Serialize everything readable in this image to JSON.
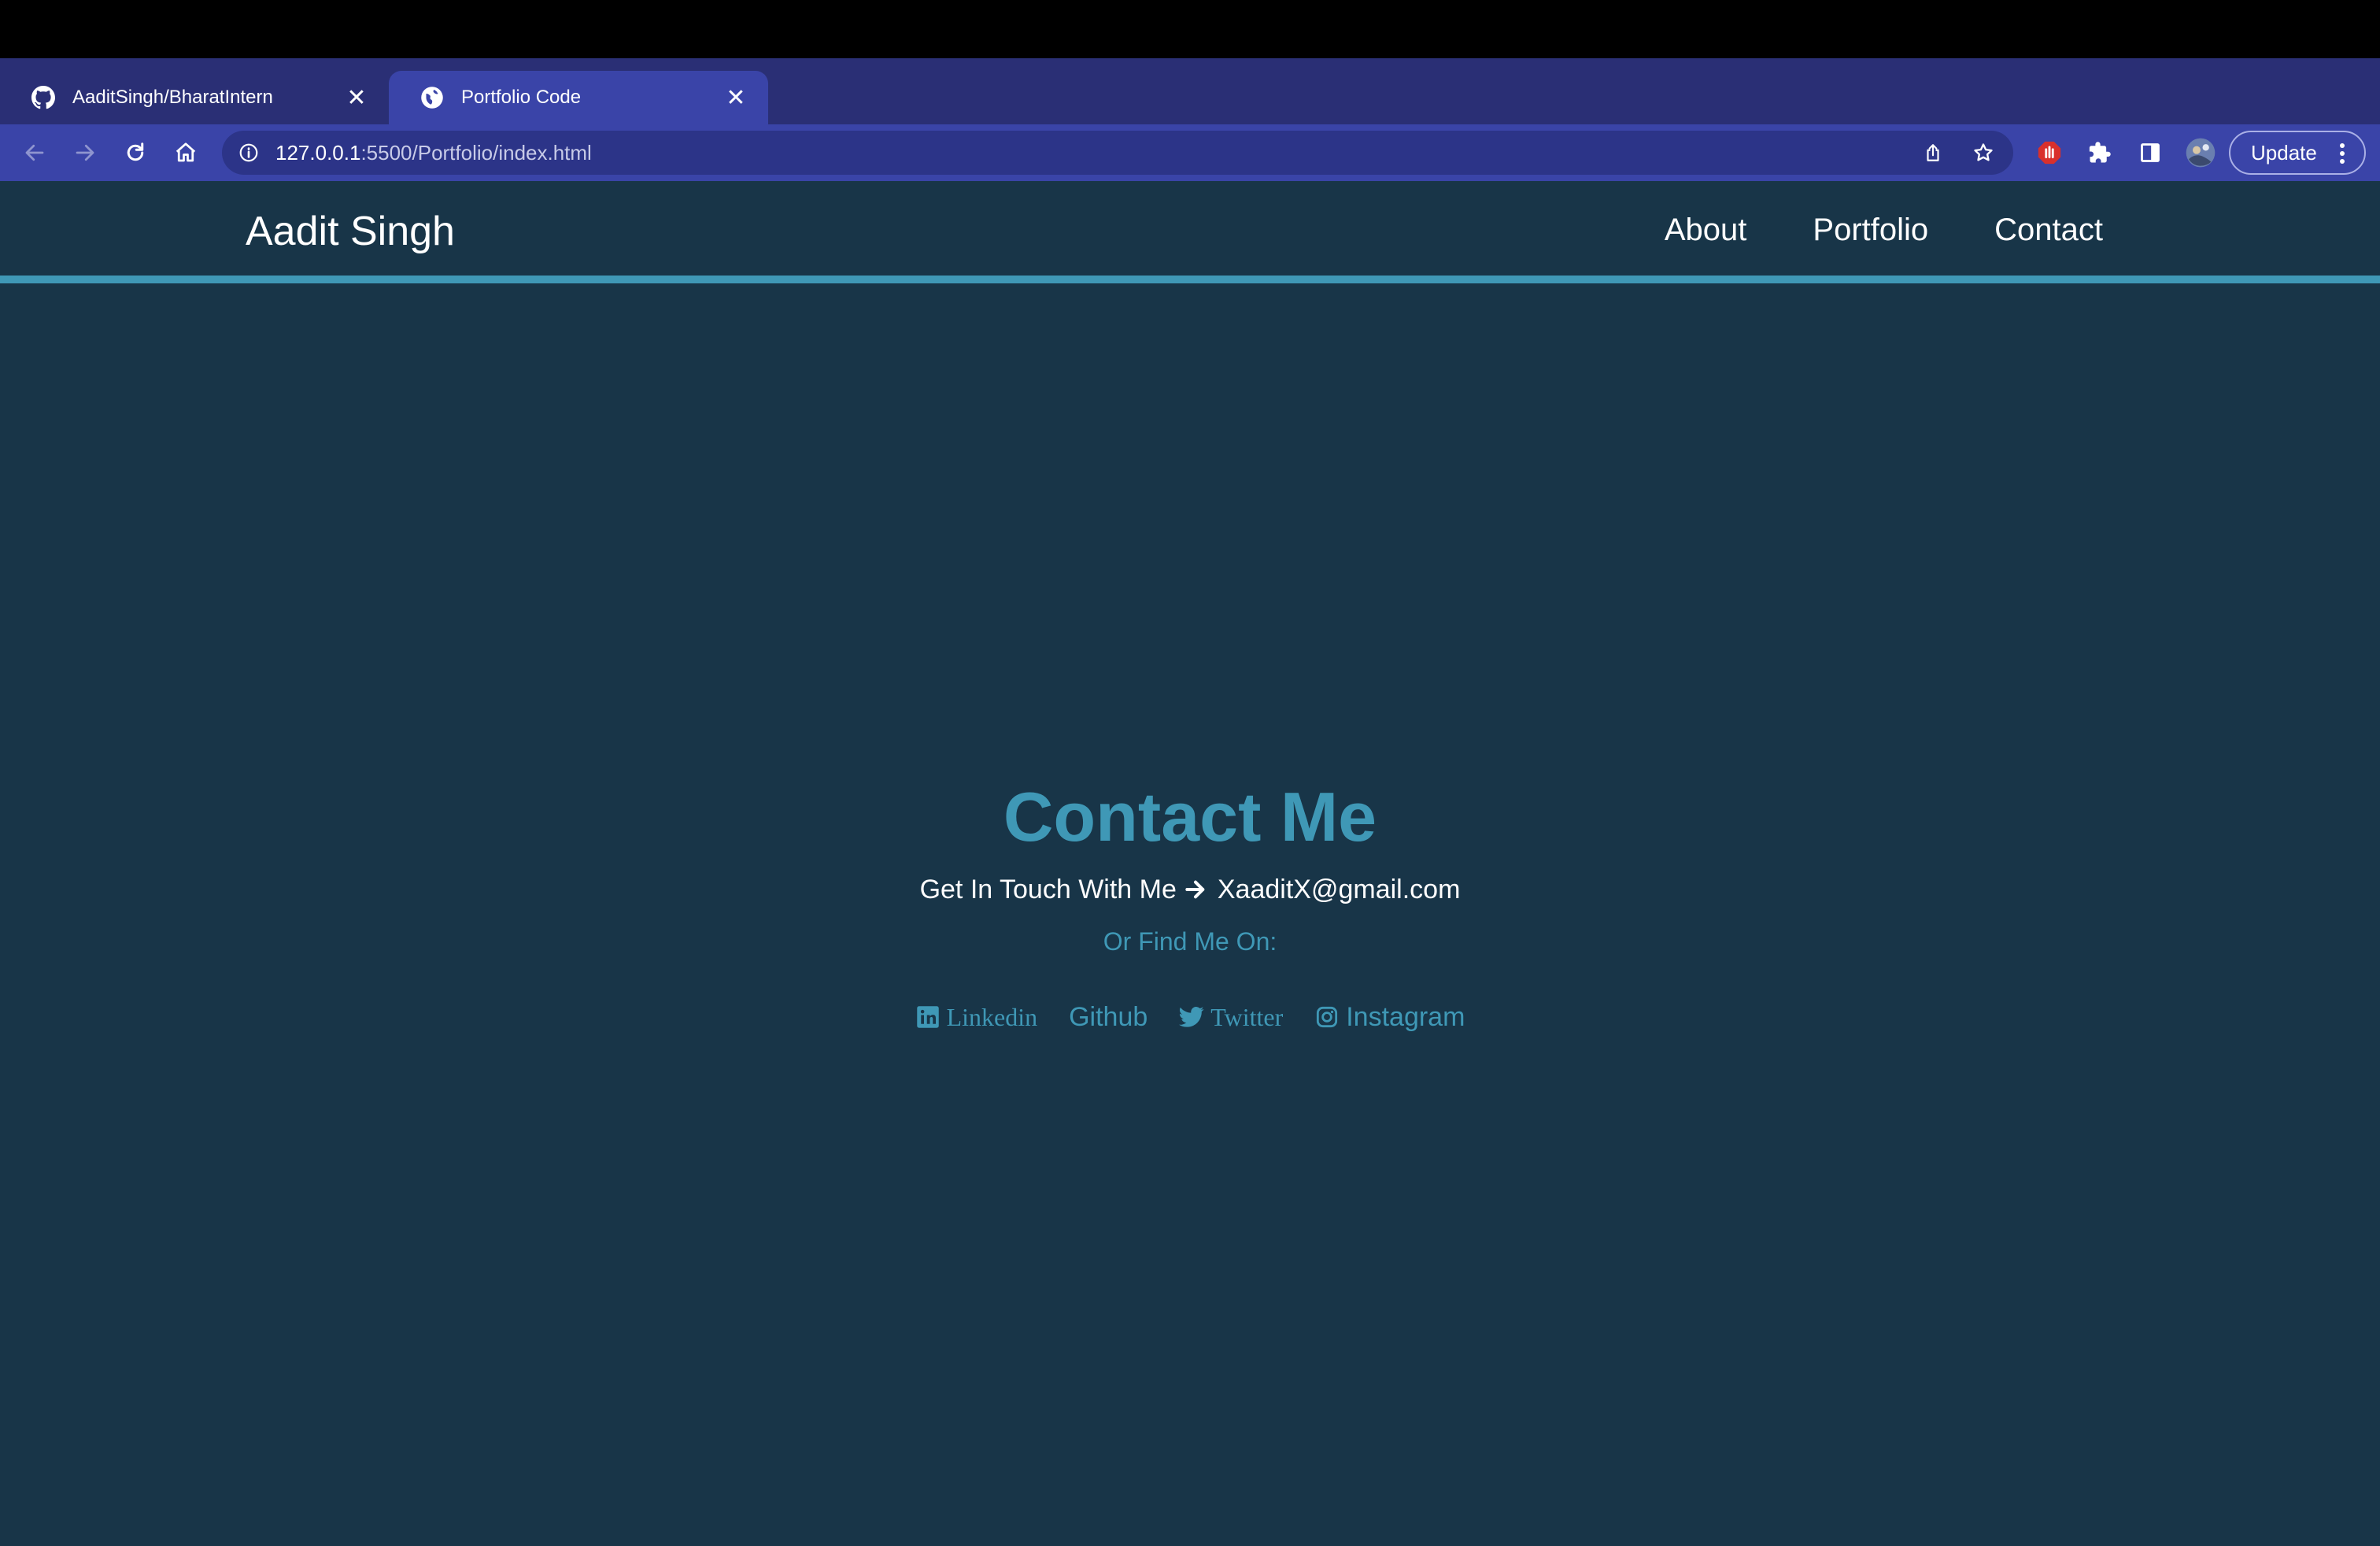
{
  "browser": {
    "tabs": [
      {
        "title": "AaditSingh/BharatIntern",
        "icon": "github-icon",
        "active": false
      },
      {
        "title": "Portfolio Code",
        "icon": "globe-icon",
        "active": true
      }
    ],
    "new_tab_symbol": "+",
    "close_symbol": "✕",
    "address": {
      "host": "127.0.0.1",
      "rest": ":5500/Portfolio/index.html"
    },
    "update_label": "Update",
    "colors": {
      "tabstrip": "#2a2f75",
      "toolbar": "#3a44a8",
      "omnibox": "#2c3488"
    }
  },
  "site": {
    "brand": "Aadit Singh",
    "nav": [
      "About",
      "Portfolio",
      "Contact"
    ],
    "contact": {
      "title": "Contact Me",
      "touch_text": "Get In Touch With Me",
      "email": "XaaditX@gmail.com",
      "find_me": "Or Find Me On:",
      "socials": [
        {
          "label": "Linkedin",
          "icon": "linkedin-icon"
        },
        {
          "label": "Github",
          "icon": ""
        },
        {
          "label": "Twitter",
          "icon": "twitter-icon"
        },
        {
          "label": "Instagram",
          "icon": "instagram-icon"
        }
      ]
    },
    "colors": {
      "background": "#183548",
      "accent": "#3f98b6",
      "text": "#ffffff"
    }
  }
}
